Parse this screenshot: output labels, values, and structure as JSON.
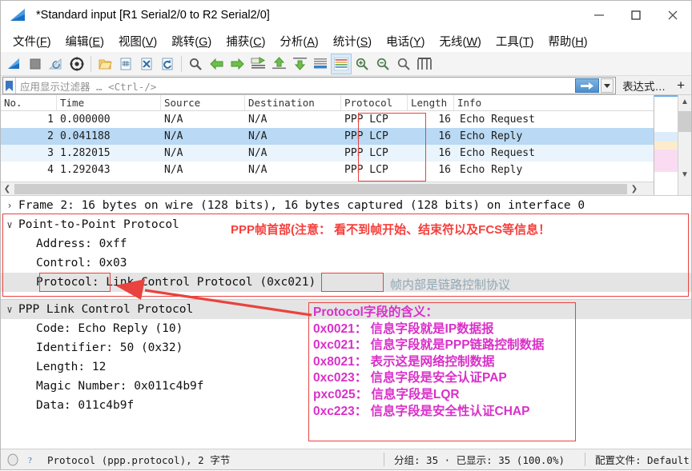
{
  "window": {
    "title": "*Standard input [R1 Serial2/0 to R2 Serial2/0]",
    "app_icon": "wireshark-fin-icon",
    "minimize_label": "—",
    "maximize_label": "□",
    "close_label": "✕"
  },
  "menubar": {
    "items": [
      {
        "name": "file",
        "text": "文件(F)",
        "pre": "文件(",
        "key": "F",
        "post": ")"
      },
      {
        "name": "edit",
        "text": "编辑(E)",
        "pre": "编辑(",
        "key": "E",
        "post": ")"
      },
      {
        "name": "view",
        "text": "视图(V)",
        "pre": "视图(",
        "key": "V",
        "post": ")"
      },
      {
        "name": "go",
        "text": "跳转(G)",
        "pre": "跳转(",
        "key": "G",
        "post": ")"
      },
      {
        "name": "capture",
        "text": "捕获(C)",
        "pre": "捕获(",
        "key": "C",
        "post": ")"
      },
      {
        "name": "analyze",
        "text": "分析(A)",
        "pre": "分析(",
        "key": "A",
        "post": ")"
      },
      {
        "name": "statistics",
        "text": "统计(S)",
        "pre": "统计(",
        "key": "S",
        "post": ")"
      },
      {
        "name": "telephony",
        "text": "电话(Y)",
        "pre": "电话(",
        "key": "Y",
        "post": ")"
      },
      {
        "name": "wireless",
        "text": "无线(W)",
        "pre": "无线(",
        "key": "W",
        "post": ")"
      },
      {
        "name": "tools",
        "text": "工具(T)",
        "pre": "工具(",
        "key": "T",
        "post": ")"
      },
      {
        "name": "help",
        "text": "帮助(H)",
        "pre": "帮助(",
        "key": "H",
        "post": ")"
      }
    ]
  },
  "toolbar": {
    "icons": [
      "start-capture-icon",
      "stop-capture-icon",
      "restart-capture-icon",
      "capture-options-icon",
      "open-file-icon",
      "save-file-icon",
      "close-file-icon",
      "reload-file-icon",
      "find-packet-icon",
      "go-back-icon",
      "go-forward-icon",
      "go-to-packet-icon",
      "go-first-packet-icon",
      "go-last-packet-icon",
      "auto-scroll-icon",
      "colorize-packets-icon",
      "zoom-in-icon",
      "zoom-out-icon",
      "zoom-reset-icon",
      "resize-columns-icon"
    ]
  },
  "filterbar": {
    "bookmark_icon": "bookmark-icon",
    "placeholder": "应用显示过滤器 … <Ctrl-/>",
    "value": "",
    "apply_icon": "apply-filter-arrow-icon",
    "dropdown_icon": "chevron-down-icon",
    "expression_label": "表达式…",
    "plus_label": "+"
  },
  "packet_list": {
    "columns": [
      "No.",
      "Time",
      "Source",
      "Destination",
      "Protocol",
      "Length",
      "Info"
    ],
    "rows": [
      {
        "no": "1",
        "time": "0.000000",
        "source": "N/A",
        "destination": "N/A",
        "protocol": "PPP LCP",
        "length": "16",
        "info": "Echo Request",
        "selected": false
      },
      {
        "no": "2",
        "time": "0.041188",
        "source": "N/A",
        "destination": "N/A",
        "protocol": "PPP LCP",
        "length": "16",
        "info": "Echo Reply",
        "selected": true
      },
      {
        "no": "3",
        "time": "1.282015",
        "source": "N/A",
        "destination": "N/A",
        "protocol": "PPP LCP",
        "length": "16",
        "info": "Echo Request",
        "selected": false
      },
      {
        "no": "4",
        "time": "1.292043",
        "source": "N/A",
        "destination": "N/A",
        "protocol": "PPP LCP",
        "length": "16",
        "info": "Echo Reply",
        "selected": false
      }
    ]
  },
  "detail_top": {
    "lines": [
      {
        "twisty": "›",
        "indent": 0,
        "text": "Frame 2: 16 bytes on wire (128 bits), 16 bytes captured (128 bits) on interface 0",
        "highlight": false
      },
      {
        "twisty": "∨",
        "indent": 0,
        "text": "Point-to-Point Protocol",
        "highlight": false
      },
      {
        "twisty": "",
        "indent": 2,
        "text": "Address: 0xff",
        "highlight": false
      },
      {
        "twisty": "",
        "indent": 2,
        "text": "Control: 0x03",
        "highlight": false
      },
      {
        "twisty": "",
        "indent": 2,
        "text": "Protocol: Link Control Protocol (0xc021)",
        "highlight": true
      }
    ]
  },
  "detail_bottom": {
    "lines": [
      {
        "twisty": "∨",
        "indent": 0,
        "text": "PPP Link Control Protocol",
        "highlight": true
      },
      {
        "twisty": "",
        "indent": 2,
        "text": "Code: Echo Reply (10)",
        "highlight": false
      },
      {
        "twisty": "",
        "indent": 2,
        "text": "Identifier: 50 (0x32)",
        "highlight": false
      },
      {
        "twisty": "",
        "indent": 2,
        "text": "Length: 12",
        "highlight": false
      },
      {
        "twisty": "",
        "indent": 2,
        "text": "Magic Number: 0x011c4b9f",
        "highlight": false
      },
      {
        "twisty": "",
        "indent": 2,
        "text": "Data: 011c4b9f",
        "highlight": false
      }
    ]
  },
  "annotations": {
    "red_note_header": "PPP帧首部(注意： 看不到帧开始、结束符以及FCS等信息！",
    "teal_note": "帧内部是链路控制协议",
    "magenta_box_lines": [
      "Protocol字段的含义：",
      "0x0021：  信息字段就是IP数据报",
      "0xc021：  信息字段就是PPP链路控制数据",
      "0x8021：  表示这是网络控制数据",
      "0xc023：  信息字段是安全认证PAP",
      "pxc025：  信息字段是LQR",
      "0xc223：  信息字段是安全性认证CHAP"
    ],
    "colors": {
      "red": "#f4403c",
      "magenta": "#d930c8",
      "teal": "#8fa7b4",
      "box_border": "#e8433f"
    }
  },
  "statusbar": {
    "left_icon": "capture-status-icon",
    "help_icon": "expert-info-icon",
    "field_info": "Protocol (ppp.protocol), 2 字节",
    "packets_info": "分组: 35 · 已显示: 35 (100.0%)",
    "profile_info": "配置文件: Default"
  }
}
